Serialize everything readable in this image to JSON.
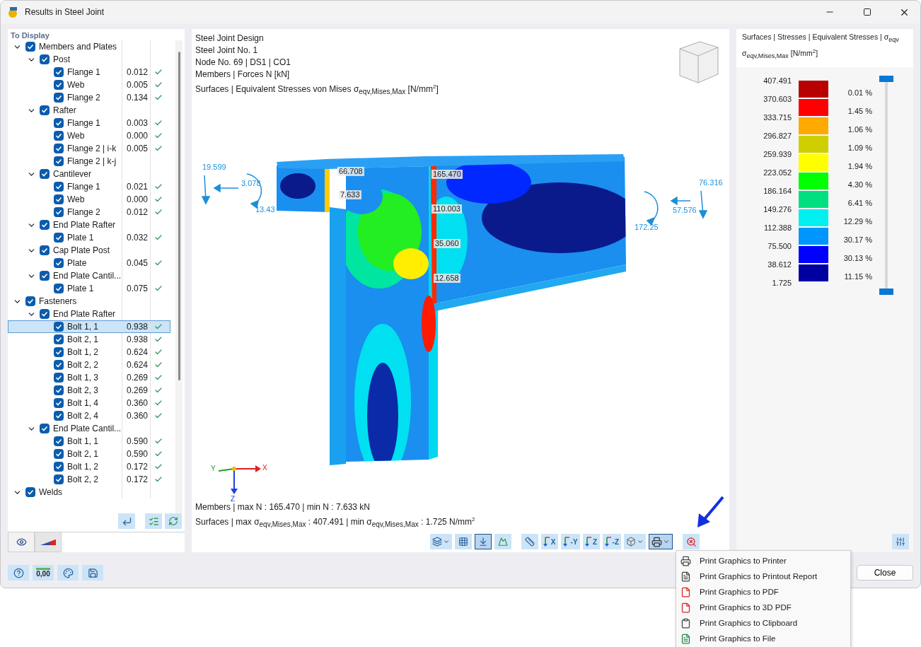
{
  "window": {
    "title": "Results in Steel Joint"
  },
  "left_panel": {
    "heading": "To Display",
    "tree": [
      {
        "label": "Members and Plates",
        "checked": true,
        "expanded": true,
        "selected": false,
        "children": [
          {
            "label": "Post",
            "checked": true,
            "expanded": true,
            "selected": false,
            "children": [
              {
                "label": "Flange 1",
                "checked": true,
                "selected": false,
                "value": "0.012",
                "passed": true
              },
              {
                "label": "Web",
                "checked": true,
                "selected": false,
                "value": "0.005",
                "passed": true
              },
              {
                "label": "Flange 2",
                "checked": true,
                "selected": false,
                "value": "0.134",
                "passed": true
              }
            ]
          },
          {
            "label": "Rafter",
            "checked": true,
            "expanded": true,
            "selected": false,
            "children": [
              {
                "label": "Flange 1",
                "checked": true,
                "selected": false,
                "value": "0.003",
                "passed": true
              },
              {
                "label": "Web",
                "checked": true,
                "selected": false,
                "value": "0.000",
                "passed": true
              },
              {
                "label": "Flange 2 | i-k",
                "checked": true,
                "selected": false,
                "value": "0.005",
                "passed": true
              },
              {
                "label": "Flange 2 | k-j",
                "checked": true,
                "selected": false
              }
            ]
          },
          {
            "label": "Cantilever",
            "checked": true,
            "expanded": true,
            "selected": false,
            "children": [
              {
                "label": "Flange 1",
                "checked": true,
                "selected": false,
                "value": "0.021",
                "passed": true
              },
              {
                "label": "Web",
                "checked": true,
                "selected": false,
                "value": "0.000",
                "passed": true
              },
              {
                "label": "Flange 2",
                "checked": true,
                "selected": false,
                "value": "0.012",
                "passed": true
              }
            ]
          },
          {
            "label": "End Plate Rafter",
            "checked": true,
            "expanded": true,
            "selected": false,
            "children": [
              {
                "label": "Plate 1",
                "checked": true,
                "selected": false,
                "value": "0.032",
                "passed": true
              }
            ]
          },
          {
            "label": "Cap Plate Post",
            "checked": true,
            "expanded": true,
            "selected": false,
            "children": [
              {
                "label": "Plate",
                "checked": true,
                "selected": false,
                "value": "0.045",
                "passed": true
              }
            ]
          },
          {
            "label": "End Plate Cantil...",
            "checked": true,
            "expanded": true,
            "selected": false,
            "children": [
              {
                "label": "Plate 1",
                "checked": true,
                "selected": false,
                "value": "0.075",
                "passed": true
              }
            ]
          }
        ]
      },
      {
        "label": "Fasteners",
        "checked": true,
        "expanded": true,
        "selected": false,
        "children": [
          {
            "label": "End Plate Rafter",
            "checked": true,
            "expanded": true,
            "selected": false,
            "children": [
              {
                "label": "Bolt 1, 1",
                "checked": true,
                "selected": true,
                "value": "0.938",
                "passed": true
              },
              {
                "label": "Bolt 2, 1",
                "checked": true,
                "selected": false,
                "value": "0.938",
                "passed": true
              },
              {
                "label": "Bolt 1, 2",
                "checked": true,
                "selected": false,
                "value": "0.624",
                "passed": true
              },
              {
                "label": "Bolt 2, 2",
                "checked": true,
                "selected": false,
                "value": "0.624",
                "passed": true
              },
              {
                "label": "Bolt 1, 3",
                "checked": true,
                "selected": false,
                "value": "0.269",
                "passed": true
              },
              {
                "label": "Bolt 2, 3",
                "checked": true,
                "selected": false,
                "value": "0.269",
                "passed": true
              },
              {
                "label": "Bolt 1, 4",
                "checked": true,
                "selected": false,
                "value": "0.360",
                "passed": true
              },
              {
                "label": "Bolt 2, 4",
                "checked": true,
                "selected": false,
                "value": "0.360",
                "passed": true
              }
            ]
          },
          {
            "label": "End Plate Cantil...",
            "checked": true,
            "expanded": true,
            "selected": false,
            "children": [
              {
                "label": "Bolt 1, 1",
                "checked": true,
                "selected": false,
                "value": "0.590",
                "passed": true
              },
              {
                "label": "Bolt 2, 1",
                "checked": true,
                "selected": false,
                "value": "0.590",
                "passed": true
              },
              {
                "label": "Bolt 1, 2",
                "checked": true,
                "selected": false,
                "value": "0.172",
                "passed": true
              },
              {
                "label": "Bolt 2, 2",
                "checked": true,
                "selected": false,
                "value": "0.172",
                "passed": true
              }
            ]
          }
        ]
      },
      {
        "label": "Welds",
        "checked": true,
        "expanded": true,
        "selected": false
      }
    ],
    "tools": [
      {
        "kind": "jump"
      },
      {
        "kind": "check-all"
      },
      {
        "kind": "toggle-all"
      }
    ],
    "tabs": [
      {
        "kind": "visibility",
        "selected": true
      },
      {
        "kind": "color-scale",
        "selected": false
      }
    ]
  },
  "view": {
    "header_lines": [
      "Steel Joint Design",
      "Steel Joint No. 1",
      "Node No. 69 | DS1 | CO1",
      "Members | Forces N [kN]",
      "Surfaces | Equivalent Stresses von Mises σ$_{eqv,Mises,Max}$ [N/mm$^{2}$]"
    ],
    "value_labels": [
      "66.708",
      "7.633",
      "165.470",
      "110.003",
      "35.060",
      "12.658"
    ],
    "force_labels": [
      "19.599",
      "3.078",
      "13.43",
      "76.316",
      "57.576",
      "172.25"
    ],
    "axes": {
      "x": "X",
      "y": "Y",
      "z": "Z"
    },
    "summary_lines": [
      "Members | max N : 165.470 | min N : 7.633 kN",
      "Surfaces | max σ$_{eqv,Mises,Max}$ : 407.491 | min σ$_{eqv,Mises,Max}$ : 1.725 N/mm$^{2}$"
    ],
    "toolbar_groups": [
      [
        {
          "kind": "surface",
          "dropdown": true,
          "pressed": false
        },
        {
          "kind": "mesh",
          "dropdown": false,
          "pressed": false
        },
        {
          "kind": "load",
          "dropdown": false,
          "pressed": true
        },
        {
          "kind": "render",
          "dropdown": false,
          "pressed": false
        }
      ],
      [
        {
          "kind": "measure",
          "dropdown": false,
          "pressed": false
        },
        {
          "kind": "axis",
          "label": "X",
          "dropdown": false,
          "pressed": false
        },
        {
          "kind": "axis",
          "label": "-Y",
          "dropdown": false,
          "pressed": false
        },
        {
          "kind": "axis",
          "label": "Z",
          "dropdown": false,
          "pressed": false
        },
        {
          "kind": "axis",
          "label": "-Z",
          "dropdown": false,
          "pressed": false
        },
        {
          "kind": "box",
          "dropdown": true,
          "pressed": false
        },
        {
          "kind": "print",
          "dropdown": true,
          "pressed": true
        }
      ],
      [
        {
          "kind": "zoom-cancel",
          "dropdown": false,
          "pressed": false
        }
      ]
    ]
  },
  "legend": {
    "title": "Surfaces | Stresses | Equivalent Stresses | σ$_{eqv}$",
    "subtitle": "σ$_{eqv,Mises,Max}$ [N/mm$^{2}$]",
    "values": [
      "407.491",
      "370.603",
      "333.715",
      "296.827",
      "259.939",
      "223.052",
      "186.164",
      "149.276",
      "112.388",
      "75.500",
      "38.612",
      "1.725"
    ],
    "slider": {
      "level": 1
    },
    "bands": [
      {
        "color": "#b80000",
        "share": "0.01 %"
      },
      {
        "color": "#ff0000",
        "share": "1.45 %"
      },
      {
        "color": "#ffaa00",
        "share": "1.06 %"
      },
      {
        "color": "#cfcf00",
        "share": "1.09 %"
      },
      {
        "color": "#ffff00",
        "share": "1.94 %"
      },
      {
        "color": "#00ff00",
        "share": "4.30 %"
      },
      {
        "color": "#00e080",
        "share": "6.41 %"
      },
      {
        "color": "#00f0f0",
        "share": "12.29 %"
      },
      {
        "color": "#0096ff",
        "share": "30.17 %"
      },
      {
        "color": "#0000ff",
        "share": "30.13 %"
      },
      {
        "color": "#0000a0",
        "share": "11.15 %"
      }
    ]
  },
  "footer": {
    "tools": [
      {
        "kind": "help"
      },
      {
        "kind": "decimals",
        "label": "0,00"
      },
      {
        "kind": "color-text"
      },
      {
        "kind": "save"
      }
    ],
    "close_button": "Close"
  },
  "print_menu": {
    "items": [
      {
        "kind": "printer",
        "label": "Print Graphics to Printer"
      },
      {
        "kind": "report",
        "label": "Print Graphics to Printout Report"
      },
      {
        "kind": "pdf",
        "label": "Print Graphics to PDF"
      },
      {
        "kind": "pdf3d",
        "label": "Print Graphics to 3D PDF"
      },
      {
        "kind": "clipboard",
        "label": "Print Graphics to Clipboard"
      },
      {
        "kind": "file",
        "label": "Print Graphics to File"
      }
    ]
  }
}
